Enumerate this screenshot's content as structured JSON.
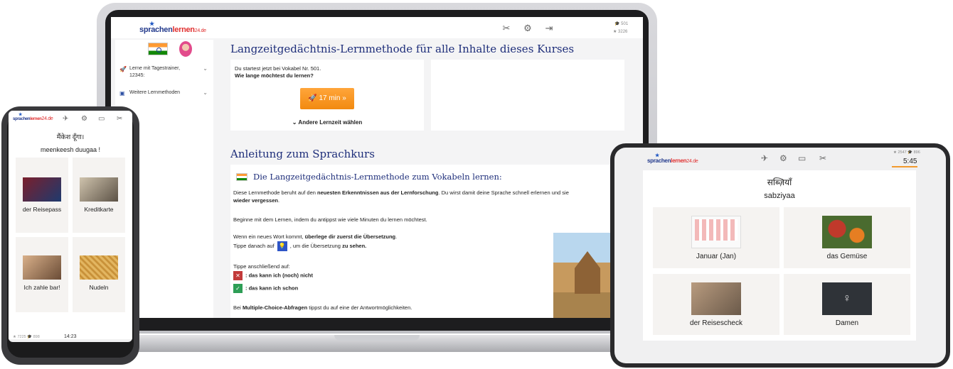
{
  "laptop": {
    "logo": {
      "a": "sprachen",
      "b": "lernen",
      "c": "24.de"
    },
    "stats": {
      "line1": "501",
      "line2": "3226"
    },
    "sidebar": {
      "items": [
        {
          "label": "Lerne mit Tagestrainer, 12345:",
          "icon": "rocket-icon"
        },
        {
          "label": "Weitere Lernmethoden",
          "icon": "book-icon"
        }
      ]
    },
    "title1": "Langzeitgedächtnis-Lernmethode für alle Inhalte dieses Kurses",
    "start_line": "Du startest jetzt bei Vokabel Nr. 501.",
    "question": "Wie lange möchtest du lernen?",
    "button": "17 min  »",
    "other_time": "Andere Lernzeit wählen",
    "title2": "Anleitung zum Sprachkurs",
    "instructions": {
      "header": "Die Langzeitgedächtnis-Lernmethode zum Vokabeln lernen:",
      "p1a": "Diese Lernmethode beruht auf den ",
      "p1b": "neuesten Erkenntnissen aus der Lernforschung",
      "p1c": ". Du wirst damit deine Sprache schnell erlernen und sie",
      "p1d": "wieder vergessen",
      "p1e": ".",
      "p2": "Beginne mit dem Lernen, indem du antippst wie viele Minuten du lernen möchtest.",
      "p3a": "Wenn ein neues Wort kommt, ",
      "p3b": "überlege dir zuerst die Übersetzung",
      "p3c": ".",
      "p4a": "Tippe danach auf",
      "p4b": ", um die Übersetzung ",
      "p4c": "zu sehen.",
      "p5": "Tippe anschließend auf:",
      "p6": ": das kann ich (noch) nicht",
      "p7": ": das kann ich schon",
      "p8a": "Bei ",
      "p8b": "Multiple-Choice-Abfragen",
      "p8c": " tippst du auf eine der Antwortmöglichkeiten."
    }
  },
  "phone": {
    "logo": {
      "a": "sprachen",
      "b": "lernen",
      "c": "24.de"
    },
    "hindi": "मैंकेश दूँगा।",
    "translit": "meenkeesh duugaa !",
    "tiles": [
      "der Reisepass",
      "Kreditkarte",
      "Ich zahle bar!",
      "Nudeln"
    ],
    "stats": "★ 7225  🎓 898",
    "time": "14:23"
  },
  "tablet": {
    "logo": {
      "a": "sprachen",
      "b": "lernen",
      "c": "24.de"
    },
    "stats": "★ 2547  🎓 896",
    "time": "5:45",
    "hindi": "सब्ज़ियाँ",
    "translit": "sabziyaa",
    "tiles": [
      "Januar (Jan)",
      "das Gemüse",
      "der Reisescheck",
      "Damen"
    ]
  },
  "colors": {
    "accent": "#f29a2e",
    "heading": "#1e2e7a",
    "brand": "#233a8c"
  }
}
